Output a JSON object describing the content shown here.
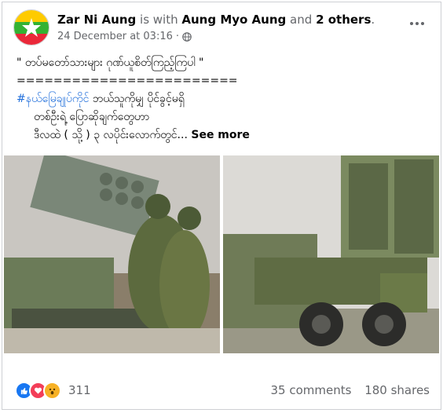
{
  "post": {
    "author": "Zar Ni Aung",
    "with_text": "is with",
    "with_name": "Aung Myo Aung",
    "and_text": "and",
    "others": "2 others",
    "date": "24 December at 03:16",
    "text": {
      "line1": "\" တပ်မတော်သားများ ဂုဏ်ယူစိတ်ကြည့်ကြပါ \"",
      "line2": "========================",
      "hashtag_prefix": "#",
      "hashtag": "#နယ်မြေချုပ်ကိုင်",
      "line3_rest": " ဘယ်သူကိုမျှ ပိုင်ခွင့်မရှိ",
      "line4": "တစ်ဦးရဲ့ ပြောဆိုချက်တွေဟာ",
      "line5": "ဒီလထဲ ( သို့ ) ၃ လပိုင်းလောက်တွင်...",
      "see_more": "See more"
    },
    "reactions": {
      "count": "311",
      "icons": [
        "like-icon",
        "love-icon",
        "wow-icon"
      ]
    },
    "comments": "35 comments",
    "shares": "180 shares"
  },
  "colors": {
    "link": "#216fdb",
    "secondary": "#65676b",
    "like": "#1877f2",
    "love": "#f33e58",
    "wow": "#f7b125"
  }
}
